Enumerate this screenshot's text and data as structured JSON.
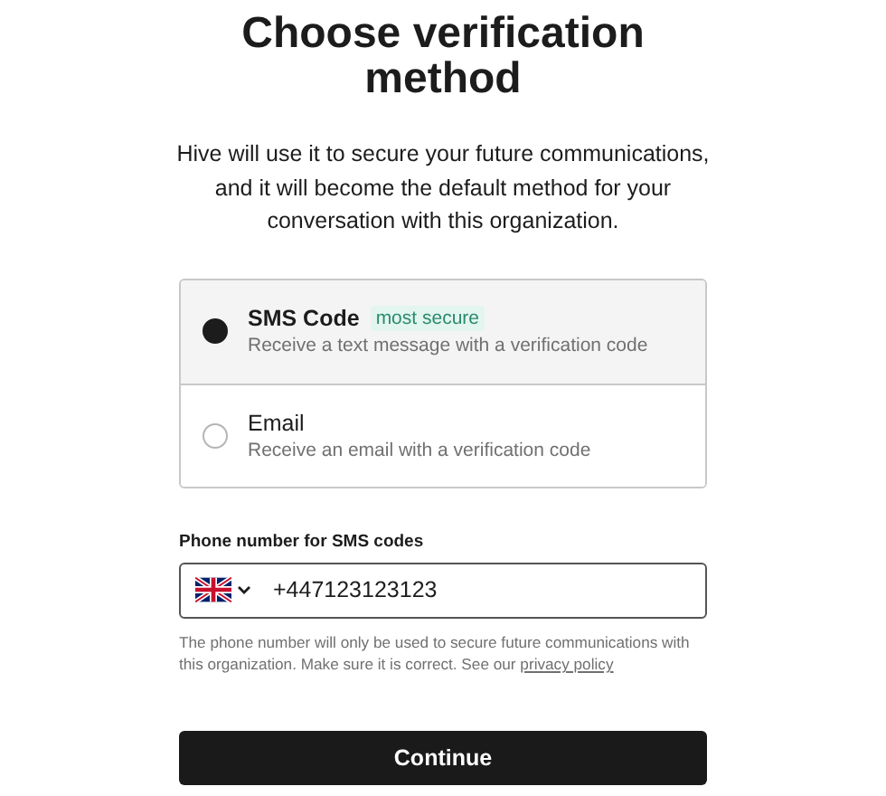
{
  "title": "Choose verification method",
  "description": "Hive will use it to secure your future communications, and it will become the default method for your conversation with this organization.",
  "options": [
    {
      "title": "SMS Code",
      "badge": "most secure",
      "description": "Receive a text message with a verification code",
      "selected": true
    },
    {
      "title": "Email",
      "description": "Receive an email with a verification code",
      "selected": false
    }
  ],
  "phone": {
    "label": "Phone number for SMS codes",
    "value": "+447123123123"
  },
  "help": {
    "text": "The phone number will only be used to secure future communications with this organization. Make sure it is correct. See our",
    "link": "privacy policy"
  },
  "button": "Continue"
}
